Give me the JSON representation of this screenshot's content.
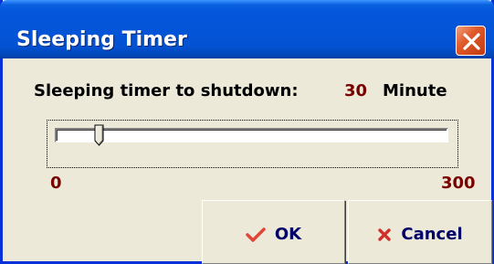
{
  "window": {
    "title": "Sleeping Timer",
    "close_icon": "close-x-icon"
  },
  "timer": {
    "label": "Sleeping timer to shutdown:",
    "value": "30",
    "unit": "Minute"
  },
  "slider": {
    "min_label": "0",
    "max_label": "300",
    "min": 0,
    "max": 300,
    "value": 30
  },
  "buttons": {
    "ok": {
      "label": "OK",
      "icon": "checkmark-icon"
    },
    "cancel": {
      "label": "Cancel",
      "icon": "x-cross-icon"
    }
  },
  "colors": {
    "titlebar": "#0454D8",
    "value_text": "#7A0000",
    "ok_icon": "#E0453A",
    "cancel_icon": "#D0302A"
  }
}
